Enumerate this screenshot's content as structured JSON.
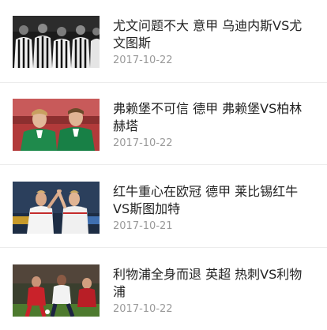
{
  "news_list": [
    {
      "title": "尤文问题不大 意甲 乌迪内斯VS尤文图斯",
      "date": "2017-10-22",
      "thumbnail": "juventus-players-photo"
    },
    {
      "title": "弗赖堡不可信 德甲 弗赖堡VS柏林赫塔",
      "date": "2017-10-22",
      "thumbnail": "werder-players-photo"
    },
    {
      "title": "红牛重心在欧冠 德甲 莱比锡红牛VS斯图加特",
      "date": "2017-10-21",
      "thumbnail": "leipzig-players-celebrating-photo"
    },
    {
      "title": "利物浦全身而退 英超 热刺VS利物浦",
      "date": "2017-10-22",
      "thumbnail": "liverpool-tottenham-match-photo"
    }
  ]
}
